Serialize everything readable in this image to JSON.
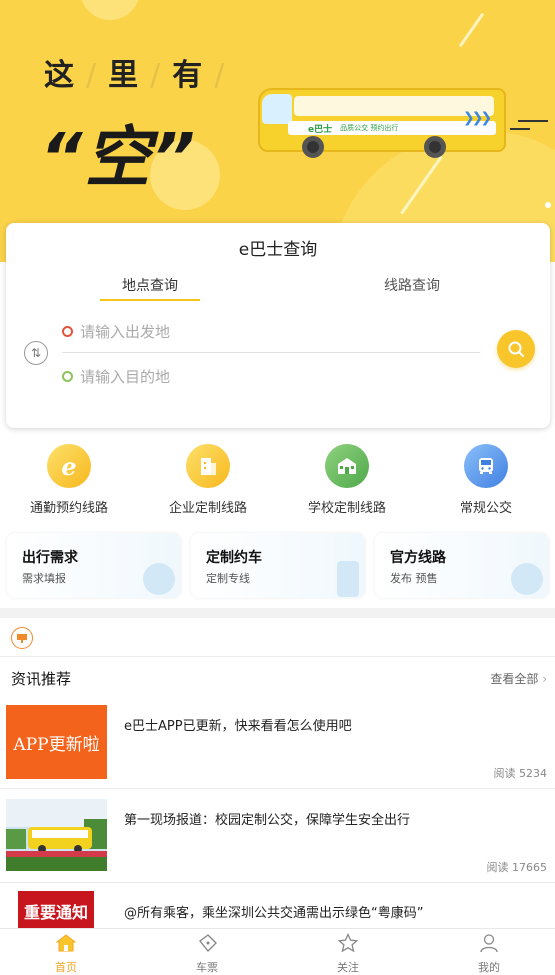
{
  "banner": {
    "line1_words": [
      "这",
      "里",
      "有"
    ],
    "headline": "“空”",
    "bus_logo": "e巴士",
    "bus_text": "品质公交 预约出行"
  },
  "query": {
    "title": "e巴士查询",
    "tab_location": "地点查询",
    "tab_route": "线路查询",
    "from_placeholder": "请输入出发地",
    "to_placeholder": "请输入目的地"
  },
  "categories": [
    {
      "label": "通勤预约线路",
      "icon": "e-logo-icon",
      "color": "#f8c62b"
    },
    {
      "label": "企业定制线路",
      "icon": "building-icon",
      "color": "#f8c62b"
    },
    {
      "label": "学校定制线路",
      "icon": "school-icon",
      "color": "#5fb85b"
    },
    {
      "label": "常规公交",
      "icon": "bus-icon",
      "color": "#4a8fe7"
    }
  ],
  "features": [
    {
      "title": "出行需求",
      "subtitle": "需求填报"
    },
    {
      "title": "定制约车",
      "subtitle": "定制专线"
    },
    {
      "title": "官方线路",
      "subtitle": "发布  预售"
    }
  ],
  "news": {
    "heading": "资讯推荐",
    "more": "查看全部",
    "items": [
      {
        "title": "e巴士APP已更新，快来看看怎么使用吧",
        "read": "阅读 5234",
        "thumb_text": "APP更新啦"
      },
      {
        "title": "第一现场报道：校园定制公交，保障学生安全出行",
        "read": "阅读 17665",
        "thumb_text": ""
      },
      {
        "title": "@所有乘客，乘坐深圳公共交通需出示绿色“粤康码”",
        "read": "",
        "thumb_text": "重要通知"
      }
    ]
  },
  "bottom_nav": [
    {
      "label": "首页",
      "icon": "home-icon",
      "active": true
    },
    {
      "label": "车票",
      "icon": "ticket-icon",
      "active": false
    },
    {
      "label": "关注",
      "icon": "star-icon",
      "active": false
    },
    {
      "label": "我的",
      "icon": "user-icon",
      "active": false
    }
  ],
  "colors": {
    "accent": "#f8c62b",
    "banner_bg": "#fbd349",
    "active_nav": "#f5a623"
  }
}
